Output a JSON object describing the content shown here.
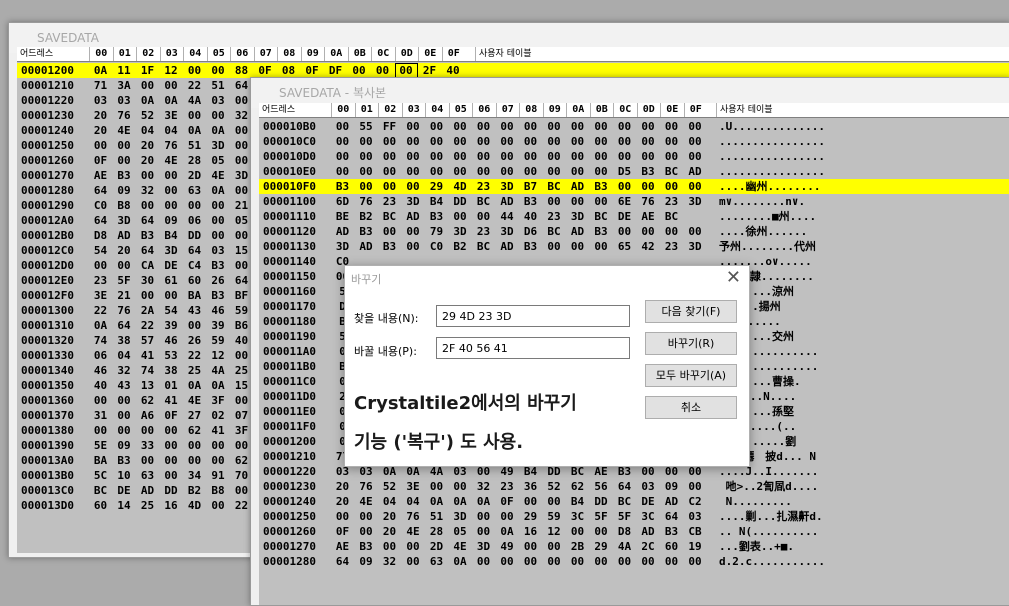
{
  "colors": {
    "selection": "#ffff00",
    "grid_bg": "#c0c0c0",
    "logo": "#e0312a"
  },
  "header": {
    "address_label": "어드레스",
    "columns": [
      "00",
      "01",
      "02",
      "03",
      "04",
      "05",
      "06",
      "07",
      "08",
      "09",
      "0A",
      "0B",
      "0C",
      "0D",
      "0E",
      "0F"
    ],
    "table_label": "사용자 테이블"
  },
  "window1": {
    "logo": "CT",
    "title": "SAVEDATA",
    "rows": [
      {
        "addr": "00001200",
        "bytes": [
          "0A",
          "11",
          "1F",
          "12",
          "00",
          "00",
          "88",
          "0F",
          "08",
          "0F",
          "DF",
          "00",
          "00",
          "00",
          "2F",
          "40"
        ],
        "selected": true
      },
      {
        "addr": "00001210",
        "bytes": [
          "71",
          "3A",
          "00",
          "00",
          "22",
          "51",
          "64"
        ]
      },
      {
        "addr": "00001220",
        "bytes": [
          "03",
          "03",
          "0A",
          "0A",
          "4A",
          "03",
          "00"
        ]
      },
      {
        "addr": "00001230",
        "bytes": [
          "20",
          "76",
          "52",
          "3E",
          "00",
          "00",
          "32"
        ]
      },
      {
        "addr": "00001240",
        "bytes": [
          "20",
          "4E",
          "04",
          "04",
          "0A",
          "0A",
          "00"
        ]
      },
      {
        "addr": "00001250",
        "bytes": [
          "00",
          "00",
          "20",
          "76",
          "51",
          "3D",
          "00"
        ]
      },
      {
        "addr": "00001260",
        "bytes": [
          "0F",
          "00",
          "20",
          "4E",
          "28",
          "05",
          "00"
        ]
      },
      {
        "addr": "00001270",
        "bytes": [
          "AE",
          "B3",
          "00",
          "00",
          "2D",
          "4E",
          "3D"
        ]
      },
      {
        "addr": "00001280",
        "bytes": [
          "64",
          "09",
          "32",
          "00",
          "63",
          "0A",
          "00"
        ]
      },
      {
        "addr": "00001290",
        "bytes": [
          "C0",
          "B8",
          "00",
          "00",
          "00",
          "00",
          "21"
        ]
      },
      {
        "addr": "000012A0",
        "bytes": [
          "64",
          "3D",
          "64",
          "09",
          "06",
          "00",
          "05"
        ]
      },
      {
        "addr": "000012B0",
        "bytes": [
          "D8",
          "AD",
          "B3",
          "B4",
          "DD",
          "00",
          "00"
        ]
      },
      {
        "addr": "000012C0",
        "bytes": [
          "54",
          "20",
          "64",
          "3D",
          "64",
          "03",
          "15"
        ]
      },
      {
        "addr": "000012D0",
        "bytes": [
          "00",
          "00",
          "CA",
          "DE",
          "C4",
          "B3",
          "00"
        ]
      },
      {
        "addr": "000012E0",
        "bytes": [
          "23",
          "5F",
          "30",
          "61",
          "60",
          "26",
          "64"
        ]
      },
      {
        "addr": "000012F0",
        "bytes": [
          "3E",
          "21",
          "00",
          "00",
          "BA",
          "B3",
          "BF"
        ]
      },
      {
        "addr": "00001300",
        "bytes": [
          "22",
          "76",
          "2A",
          "54",
          "43",
          "46",
          "59"
        ]
      },
      {
        "addr": "00001310",
        "bytes": [
          "0A",
          "64",
          "22",
          "39",
          "00",
          "39",
          "B6"
        ]
      },
      {
        "addr": "00001320",
        "bytes": [
          "74",
          "38",
          "57",
          "46",
          "26",
          "59",
          "40"
        ]
      },
      {
        "addr": "00001330",
        "bytes": [
          "06",
          "04",
          "41",
          "53",
          "22",
          "12",
          "00"
        ]
      },
      {
        "addr": "00001340",
        "bytes": [
          "46",
          "32",
          "74",
          "38",
          "25",
          "4A",
          "25"
        ]
      },
      {
        "addr": "00001350",
        "bytes": [
          "40",
          "43",
          "13",
          "01",
          "0A",
          "0A",
          "15"
        ]
      },
      {
        "addr": "00001360",
        "bytes": [
          "00",
          "00",
          "62",
          "41",
          "4E",
          "3F",
          "00"
        ]
      },
      {
        "addr": "00001370",
        "bytes": [
          "31",
          "00",
          "A6",
          "0F",
          "27",
          "02",
          "07"
        ]
      },
      {
        "addr": "00001380",
        "bytes": [
          "00",
          "00",
          "00",
          "00",
          "62",
          "41",
          "3F"
        ]
      },
      {
        "addr": "00001390",
        "bytes": [
          "5E",
          "09",
          "33",
          "00",
          "00",
          "00",
          "00"
        ]
      },
      {
        "addr": "000013A0",
        "bytes": [
          "BA",
          "B3",
          "00",
          "00",
          "00",
          "00",
          "62"
        ]
      },
      {
        "addr": "000013B0",
        "bytes": [
          "5C",
          "10",
          "63",
          "00",
          "34",
          "91",
          "70"
        ]
      },
      {
        "addr": "000013C0",
        "bytes": [
          "BC",
          "DE",
          "AD",
          "DD",
          "B2",
          "B8",
          "00"
        ]
      },
      {
        "addr": "000013D0",
        "bytes": [
          "60",
          "14",
          "25",
          "16",
          "4D",
          "00",
          "22"
        ]
      }
    ]
  },
  "window2": {
    "logo": "CT",
    "title": "SAVEDATA - 복사본",
    "rows": [
      {
        "addr": "000010B0",
        "bytes": [
          "00",
          "55",
          "FF",
          "00",
          "00",
          "00",
          "00",
          "00",
          "00",
          "00",
          "00",
          "00",
          "00",
          "00",
          "00",
          "00"
        ],
        "text": ".U.............."
      },
      {
        "addr": "000010C0",
        "bytes": [
          "00",
          "00",
          "00",
          "00",
          "00",
          "00",
          "00",
          "00",
          "00",
          "00",
          "00",
          "00",
          "00",
          "00",
          "00",
          "00"
        ],
        "text": "................"
      },
      {
        "addr": "000010D0",
        "bytes": [
          "00",
          "00",
          "00",
          "00",
          "00",
          "00",
          "00",
          "00",
          "00",
          "00",
          "00",
          "00",
          "00",
          "00",
          "00",
          "00"
        ],
        "text": "................"
      },
      {
        "addr": "000010E0",
        "bytes": [
          "00",
          "00",
          "00",
          "00",
          "00",
          "00",
          "00",
          "00",
          "00",
          "00",
          "00",
          "00",
          "D5",
          "B3",
          "BC",
          "AD"
        ],
        "text": "................"
      },
      {
        "addr": "000010F0",
        "bytes": [
          "B3",
          "00",
          "00",
          "00",
          "29",
          "4D",
          "23",
          "3D",
          "B7",
          "BC",
          "AD",
          "B3",
          "00",
          "00",
          "00",
          "00"
        ],
        "text": "....幽州........",
        "selected": true
      },
      {
        "addr": "00001100",
        "bytes": [
          "6D",
          "76",
          "23",
          "3D",
          "B4",
          "DD",
          "BC",
          "AD",
          "B3",
          "00",
          "00",
          "00",
          "6E",
          "76",
          "23",
          "3D"
        ],
        "text": "m∨........n∨."
      },
      {
        "addr": "00001110",
        "bytes": [
          "BE",
          "B2",
          "BC",
          "AD",
          "B3",
          "00",
          "00",
          "44",
          "40",
          "23",
          "3D",
          "BC",
          "DE",
          "AE",
          "BC"
        ],
        "text": "........■州...."
      },
      {
        "addr": "00001120",
        "bytes": [
          "AD",
          "B3",
          "00",
          "00",
          "79",
          "3D",
          "23",
          "3D",
          "D6",
          "BC",
          "AD",
          "B3",
          "00",
          "00",
          "00",
          "00"
        ],
        "text": "....徐州......"
      },
      {
        "addr": "00001130",
        "bytes": [
          "3D",
          "AD",
          "B3",
          "00",
          "C0",
          "B2",
          "BC",
          "AD",
          "B3",
          "00",
          "00",
          "00",
          "65",
          "42",
          "23",
          "3D"
        ],
        "text": "予州........代州"
      },
      {
        "addr": "00001140",
        "bytes": [
          "C0"
        ],
        "text": ".......o∨....."
      },
      {
        "addr": "00001150",
        "bytes": [
          "00"
        ],
        "text": "   司隷........"
      },
      {
        "addr": "00001160",
        "bytes": [
          "5"
        ],
        "text": "........涼州"
      },
      {
        "addr": "00001170",
        "bytes": [
          "D"
        ],
        "text": "......揚州"
      },
      {
        "addr": "00001180",
        "bytes": [
          "B"
        ],
        "text": "荊州......"
      },
      {
        "addr": "00001190",
        "bytes": [
          "5"
        ],
        "text": "........交州"
      },
      {
        "addr": "000011A0",
        "bytes": [
          "0"
        ],
        "text": "..............."
      },
      {
        "addr": "000011B0",
        "bytes": [
          "B"
        ],
        "text": "..............."
      },
      {
        "addr": "000011C0",
        "bytes": [
          "0"
        ],
        "text": "........曹操."
      },
      {
        "addr": "000011D0",
        "bytes": [
          "2"
        ],
        "text": "孫d....N...."
      },
      {
        "addr": "000011E0",
        "bytes": [
          "0"
        ],
        "text": "........孫堅"
      },
      {
        "addr": "000011F0",
        "bytes": [
          "0"
        ],
        "text": "獗b.d....(.."
      },
      {
        "addr": "00001200",
        "bytes": [
          "0"
        ],
        "text": "..........劉"
      },
      {
        "addr": "00001210",
        "bytes": [
          "77",
          "48",
          "00",
          "00",
          "22",
          "51",
          "64",
          "4F",
          "64",
          "48",
          "64",
          "03",
          "02",
          "00",
          "20",
          "4E"
        ],
        "text": "備..僊　披d... N"
      },
      {
        "addr": "00001220",
        "bytes": [
          "03",
          "03",
          "0A",
          "0A",
          "4A",
          "03",
          "00",
          "49",
          "B4",
          "DD",
          "BC",
          "AE",
          "B3",
          "00",
          "00",
          "00"
        ],
        "text": "....J..I......."
      },
      {
        "addr": "00001230",
        "bytes": [
          "20",
          "76",
          "52",
          "3E",
          "00",
          "00",
          "32",
          "23",
          "36",
          "52",
          "62",
          "56",
          "64",
          "03",
          "09",
          "00"
        ],
        "text": " 吔>..2訇凮d...."
      },
      {
        "addr": "00001240",
        "bytes": [
          "20",
          "4E",
          "04",
          "04",
          "0A",
          "0A",
          "0A",
          "0F",
          "00",
          "00",
          "B4",
          "DD",
          "BC",
          "DE",
          "AD",
          "C2"
        ],
        "text": " N........."
      },
      {
        "addr": "00001250",
        "bytes": [
          "00",
          "00",
          "20",
          "76",
          "51",
          "3D",
          "00",
          "00",
          "29",
          "59",
          "3C",
          "5F",
          "5F",
          "3C",
          "64",
          "03"
        ],
        "text": "....剿...扎濕鼾d."
      },
      {
        "addr": "00001260",
        "bytes": [
          "0F",
          "00",
          "20",
          "4E",
          "28",
          "05",
          "00",
          "0A",
          "16",
          "12",
          "00",
          "00",
          "D8",
          "AD",
          "B3",
          "CB"
        ],
        "text": ".. N(.........."
      },
      {
        "addr": "00001270",
        "bytes": [
          "AE",
          "B3",
          "00",
          "00",
          "2D",
          "4E",
          "3D",
          "49",
          "00",
          "00",
          "2B",
          "29",
          "4A",
          "2C",
          "60",
          "19"
        ],
        "text": "...劉表..+■."
      },
      {
        "addr": "00001280",
        "bytes": [
          "64",
          "09",
          "32",
          "00",
          "63",
          "0A",
          "00",
          "00",
          "00",
          "00",
          "00",
          "00",
          "00",
          "00",
          "00",
          "00"
        ],
        "text": "d.2.c..........."
      }
    ]
  },
  "dialog": {
    "title": "바꾸기",
    "find_label": "찾을 내용(N):",
    "find_value": "29 4D 23 3D",
    "replace_label": "바꿀 내용(P):",
    "replace_value": "2F 40 56 41",
    "btn_find_next": "다음 찾기(F)",
    "btn_replace": "바꾸기(R)",
    "btn_replace_all": "모두 바꾸기(A)",
    "btn_cancel": "취소",
    "note_line1": "Crystaltile2에서의 바꾸기",
    "note_line2": "기능 ('복구') 도 사용.",
    "close_glyph": "✕"
  }
}
